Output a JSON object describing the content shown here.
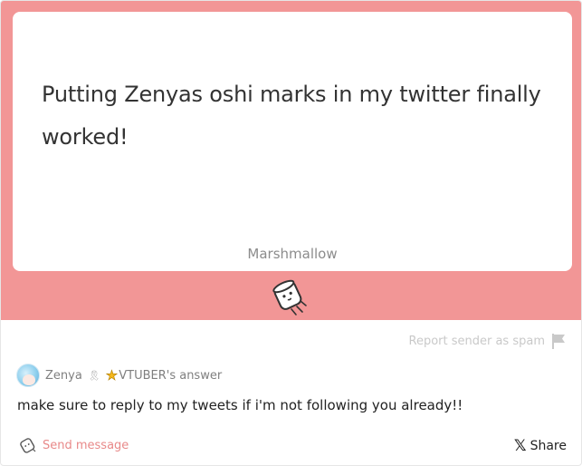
{
  "question": {
    "text": "Putting Zenyas oshi marks in my twitter finally worked!",
    "brand": "Marshmallow",
    "mascot_icon": "marshmallow-mascot-icon"
  },
  "report": {
    "label": "Report sender as spam",
    "icon": "flag-icon"
  },
  "answer": {
    "author": "Zenya",
    "author_suffix": "VTUBER's answer",
    "badge_icon": "ribbon-icon",
    "star_icon": "star-icon",
    "text": "make sure to reply to my tweets if i'm not following you already!!"
  },
  "actions": {
    "send_message": "Send message",
    "share": "Share",
    "share_icon": "x-logo-icon"
  },
  "colors": {
    "accent_pink": "#f29696",
    "link_pink": "#e88989"
  }
}
